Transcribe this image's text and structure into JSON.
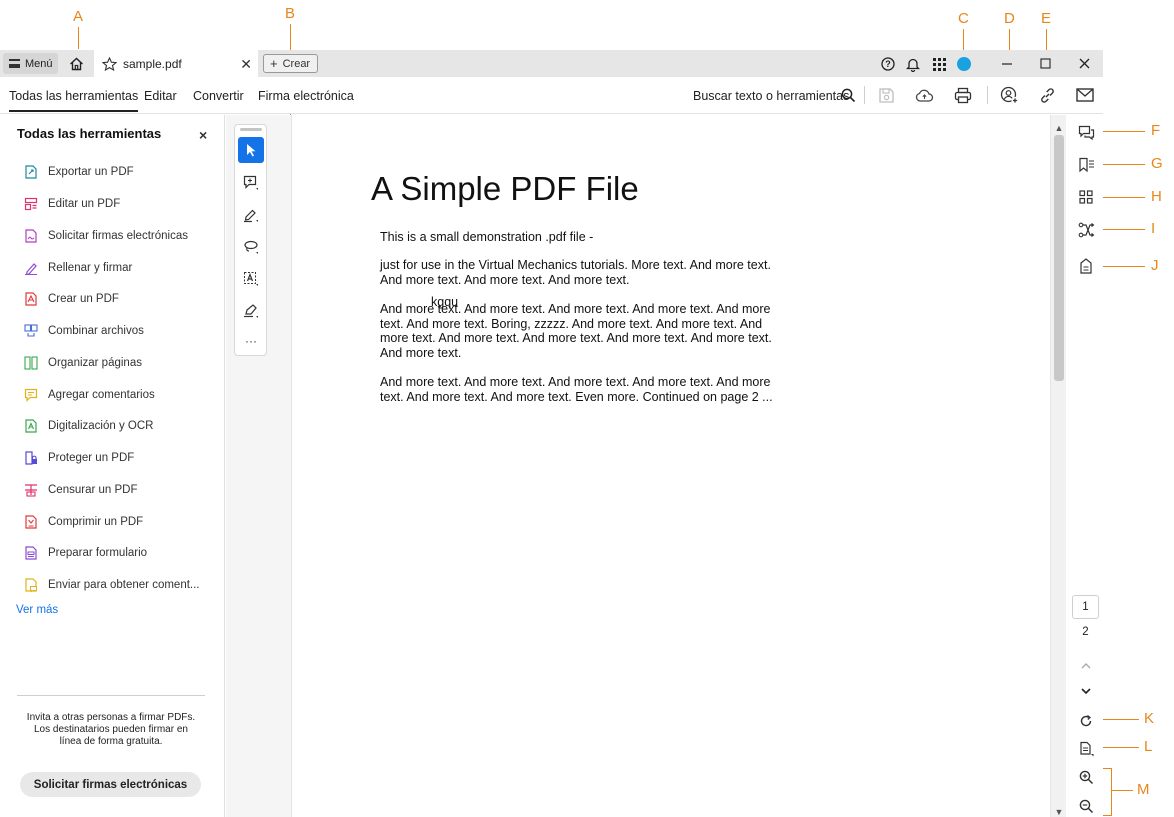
{
  "callouts": [
    "A",
    "B",
    "C",
    "D",
    "E",
    "F",
    "G",
    "H",
    "I",
    "J",
    "K",
    "L",
    "M"
  ],
  "titlebar": {
    "menu_label": "Menú",
    "tab_title": "sample.pdf",
    "tab_close": "✕",
    "create_label": "Crear"
  },
  "toolbar": {
    "tabs": [
      "Todas las herramientas",
      "Editar",
      "Convertir",
      "Firma electrónica"
    ],
    "search_label": "Buscar texto o herramientas"
  },
  "left_panel": {
    "title": "Todas las herramientas",
    "close": "×",
    "items": [
      {
        "label": "Exportar un PDF",
        "color": "#1a8a9c"
      },
      {
        "label": "Editar un PDF",
        "color": "#e0326e"
      },
      {
        "label": "Solicitar firmas electrónicas",
        "color": "#b13cc4"
      },
      {
        "label": "Rellenar y firmar",
        "color": "#8a4bd6"
      },
      {
        "label": "Crear un PDF",
        "color": "#e03a3a"
      },
      {
        "label": "Combinar archivos",
        "color": "#4b6cd6"
      },
      {
        "label": "Organizar páginas",
        "color": "#39a84b"
      },
      {
        "label": "Agregar comentarios",
        "color": "#e0b41a"
      },
      {
        "label": "Digitalización y OCR",
        "color": "#39a84b"
      },
      {
        "label": "Proteger un PDF",
        "color": "#5a4bd6"
      },
      {
        "label": "Censurar un PDF",
        "color": "#e0326e"
      },
      {
        "label": "Comprimir un PDF",
        "color": "#e03a3a"
      },
      {
        "label": "Preparar formulario",
        "color": "#8a4bd6"
      },
      {
        "label": "Enviar para obtener coment...",
        "color": "#e0b41a"
      }
    ],
    "see_more": "Ver más",
    "invite_line1": "Invita a otras personas a firmar PDFs.",
    "invite_line2": "Los destinatarios pueden firmar en línea de forma gratuita.",
    "cta": "Solicitar firmas electrónicas"
  },
  "tool_column": {
    "more": "···"
  },
  "document": {
    "title": "A Simple PDF File",
    "p1": "This is a small demonstration .pdf file -",
    "p2": "just for use in the Virtual Mechanics tutorials. More text. And more text. And more text. And more text. And more text.",
    "p3": "And more text. And more text. And more text. And more text. And more text. And more text. Boring, zzzzz. And more text. And more text. And more text. And more text. And more text. And more text. And more text. And more text.",
    "p4": "And more text. And more text. And more text. And more text. And more text. And more text. And more text. Even more. Continued on page 2 ...",
    "overlay_text": "kgqu"
  },
  "page_nav": {
    "current": "1",
    "next": "2"
  },
  "colors": {
    "accent": "#1473e6",
    "callout": "#e8861a",
    "avatar": "#1aa1e0"
  }
}
